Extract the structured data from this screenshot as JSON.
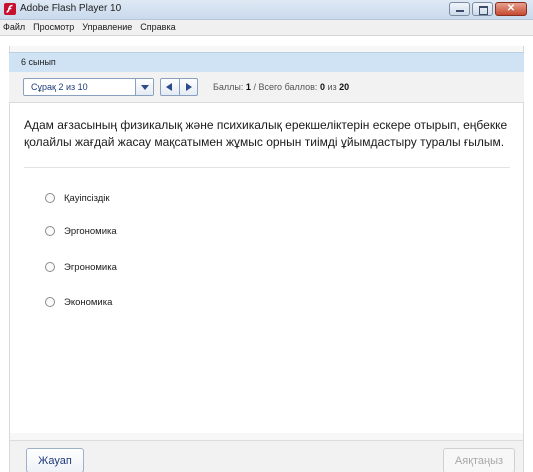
{
  "window": {
    "title": "Adobe Flash Player 10"
  },
  "menu": {
    "items": [
      "Файл",
      "Просмотр",
      "Управление",
      "Справка"
    ]
  },
  "header": {
    "grade": "6 сынып"
  },
  "toolbar": {
    "question_select": "Сұрақ 2 из 10",
    "score_label": "Баллы:",
    "score_value": "1",
    "separator": "/",
    "total_label": "Всего баллов:",
    "total_value": "0",
    "total_of": "из",
    "total_max": "20"
  },
  "question": {
    "text": "Адам ағзасының физикалық және психикалық ерекшеліктерін ескере отырып, еңбекке қолайлы жағдай жасау мақсатымен жұмыс орнын тиімді ұйымдастыру туралы ғылым.",
    "options": [
      "Қауіпсіздік",
      "Эргономика",
      "Эгрономика",
      "Экономика"
    ]
  },
  "footer": {
    "answer_button": "Жауап",
    "finish_button": "Аяқтаңыз"
  },
  "colors": {
    "accent": "#1f3c7a",
    "header_bg": "#cfe3f4",
    "flash_red": "#c8102e"
  }
}
